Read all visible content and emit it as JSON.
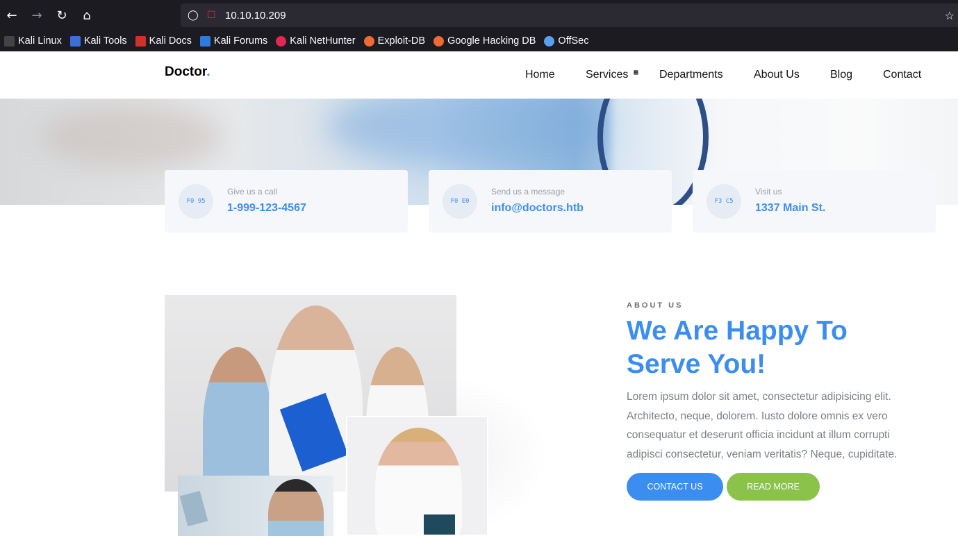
{
  "browser": {
    "url": "10.10.10.209",
    "bookmarks": [
      {
        "label": "Kali Linux",
        "color": "#367bf0"
      },
      {
        "label": "Kali Tools",
        "color": "#e22850"
      },
      {
        "label": "Kali Docs",
        "color": "#d0312d"
      },
      {
        "label": "Kali Forums",
        "color": "#2d7be0"
      },
      {
        "label": "Kali NetHunter",
        "color": "#e22850"
      },
      {
        "label": "Exploit-DB",
        "color": "#f06a35"
      },
      {
        "label": "Google Hacking DB",
        "color": "#f06a35"
      },
      {
        "label": "OffSec",
        "color": "#5aa0f0"
      }
    ]
  },
  "site": {
    "logo": "Doctor",
    "logo_dot": ".",
    "accent": "#3b8ef0",
    "menu": {
      "home": "Home",
      "services": "Services",
      "departments": "Departments",
      "about": "About Us",
      "blog": "Blog",
      "contact": "Contact"
    },
    "cards": [
      {
        "small": "Give us a call",
        "big": "1-999-123-4567",
        "icon": "phone-icon",
        "glyph": "F0 95"
      },
      {
        "small": "Send us a message",
        "big": "info@doctors.htb",
        "icon": "mail-icon",
        "glyph": "F0 E0"
      },
      {
        "small": "Visit us",
        "big": "1337 Main St.",
        "icon": "location-icon",
        "glyph": "F3 C5"
      }
    ],
    "about": {
      "eyebrow": "ABOUT US",
      "heading": "We Are Happy To Serve You!",
      "paragraph": "Lorem ipsum dolor sit amet, consectetur adipisicing elit. Architecto, neque, dolorem. Iusto dolore omnis ex vero consequatur et deserunt officia incidunt at illum corrupti adipisci consectetur, veniam veritatis? Neque, cupiditate.",
      "contact_button": "CONTACT US",
      "read_more_button": "READ MORE",
      "green": "#8bc34a"
    }
  }
}
